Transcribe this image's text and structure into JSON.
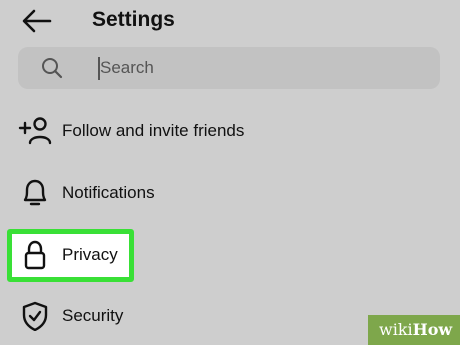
{
  "header": {
    "back_icon": "arrow-left-icon",
    "title": "Settings"
  },
  "search": {
    "icon": "search-icon",
    "placeholder": "Search",
    "value": ""
  },
  "menu": [
    {
      "icon": "add-person-icon",
      "label": "Follow and invite friends"
    },
    {
      "icon": "bell-icon",
      "label": "Notifications"
    },
    {
      "icon": "lock-icon",
      "label": "Privacy",
      "highlighted": true
    },
    {
      "icon": "shield-check-icon",
      "label": "Security"
    }
  ],
  "colors": {
    "background": "#cecece",
    "highlight": "#39e036",
    "search_bg": "#c2c2c2"
  },
  "watermark": {
    "prefix": "wiki",
    "suffix": "How"
  }
}
